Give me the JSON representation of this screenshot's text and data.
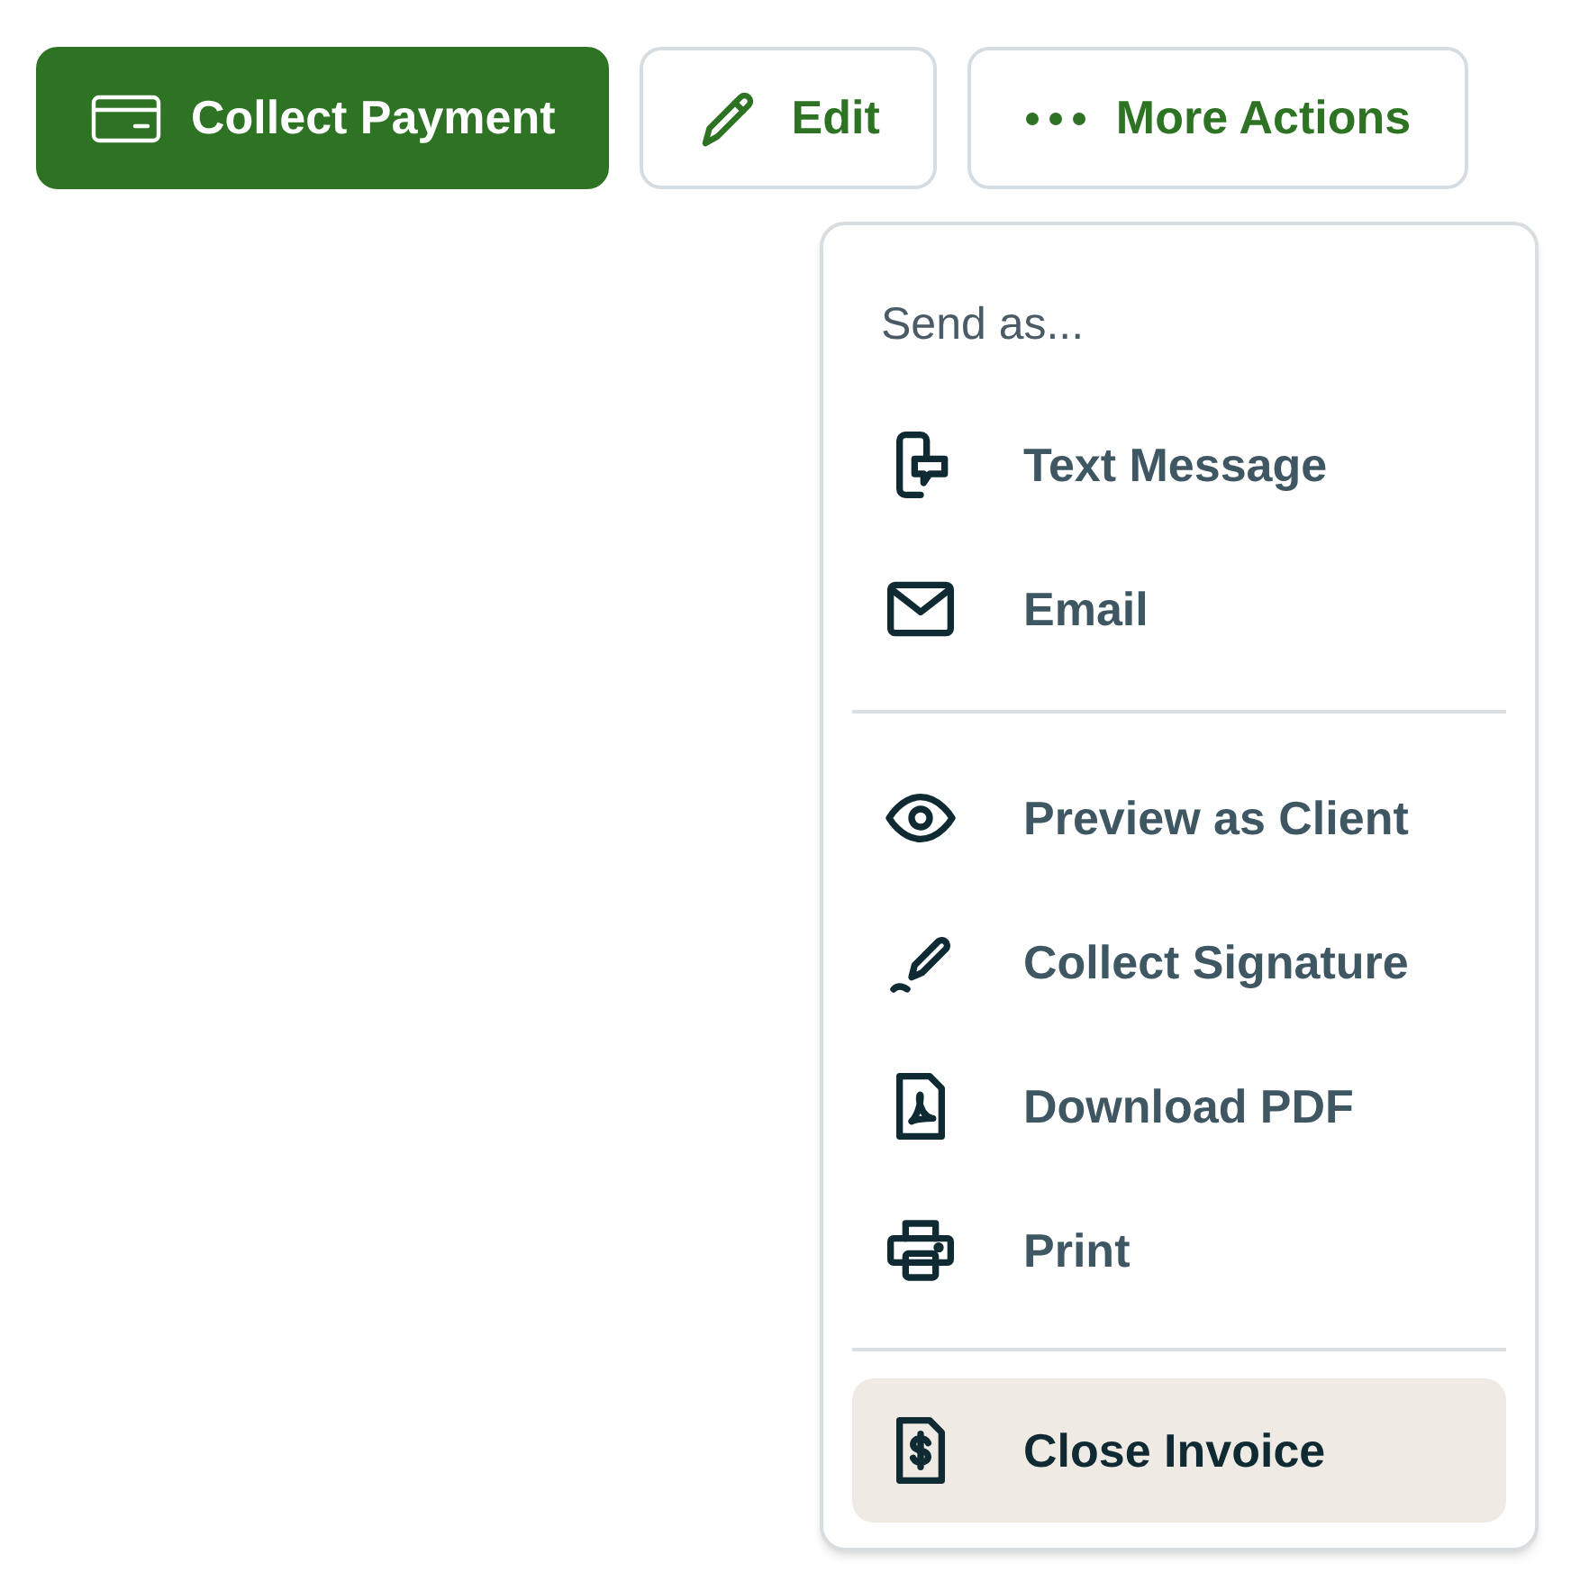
{
  "toolbar": [
    {
      "kind": "primary",
      "label": "Collect Payment"
    },
    {
      "kind": "outline",
      "label": "Edit"
    },
    {
      "kind": "outline",
      "label": "More Actions"
    }
  ],
  "menu": {
    "header": "Send as...",
    "sections": [
      [
        {
          "label": "Text Message",
          "highlighted": false
        },
        {
          "label": "Email",
          "highlighted": false
        }
      ],
      [
        {
          "label": "Preview as Client",
          "highlighted": false
        },
        {
          "label": "Collect Signature",
          "highlighted": false
        },
        {
          "label": "Download PDF",
          "highlighted": false
        },
        {
          "label": "Print",
          "highlighted": false
        }
      ],
      [
        {
          "label": "Close Invoice",
          "highlighted": true
        }
      ]
    ]
  }
}
